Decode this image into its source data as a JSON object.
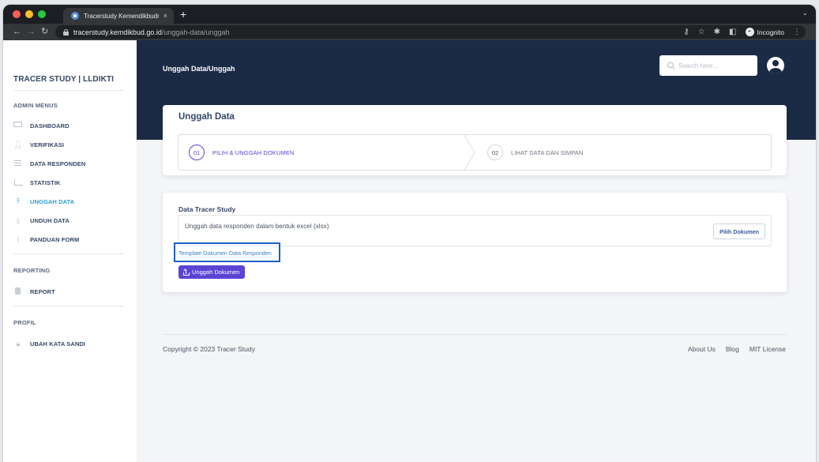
{
  "browser": {
    "tab_title": "Tracerstudy Kemendikbudristek",
    "tab_close": "×",
    "new_tab": "+",
    "tab_menu": "⌄",
    "url_host": "tracerstudy.kemdikbud.go.id",
    "url_path": "/unggah-data/unggah",
    "incognito_label": "Incognito",
    "colors": {
      "tabbar": "#1c1e23",
      "toolbar": "#35363a"
    }
  },
  "sidebar": {
    "brand": "TRACER STUDY | LLDIKTI",
    "sections": {
      "admin": "ADMIN MENUS",
      "reporting": "REPORTING",
      "profile": "PROFIL"
    },
    "items": [
      {
        "label": "DASHBOARD",
        "icon": "monitor-icon"
      },
      {
        "label": "VERIFIKASI",
        "icon": "user-check-icon"
      },
      {
        "label": "DATA RESPONDEN",
        "icon": "list-icon"
      },
      {
        "label": "STATISTIK",
        "icon": "chart-icon"
      },
      {
        "label": "UNGGAH DATA",
        "icon": "upload-icon",
        "active": true
      },
      {
        "label": "UNDUH DATA",
        "icon": "download-icon"
      },
      {
        "label": "PANDUAN FORM",
        "icon": "info-icon"
      }
    ],
    "report_item": "REPORT",
    "password_item": "UBAH KATA SANDI",
    "active_color": "#2d9ad8"
  },
  "header": {
    "breadcrumb": "Unggah Data/Unggah",
    "search_placeholder": "Search here...",
    "bg_color": "#1b2a45"
  },
  "wizard": {
    "title": "Unggah Data",
    "steps": [
      {
        "number": "01",
        "label": "PILIH & UNGGAH DOKUMEN",
        "active": true
      },
      {
        "number": "02",
        "label": "LIHAT DATA DAN SIMPAN",
        "active": false
      }
    ],
    "accent_color": "#5b44d4"
  },
  "upload": {
    "title": "Data Tracer Study",
    "description": "Unggah data responden dalam bentuk excel (xlsx)",
    "pick_button": "Pilih Dokumen",
    "template_link": "Template Dokumen Data Responden",
    "upload_button": "Unggah Dokumen"
  },
  "footer": {
    "copyright": "Copyright © 2023 Tracer Study",
    "links": [
      "About Us",
      "Blog",
      "MIT License"
    ]
  }
}
